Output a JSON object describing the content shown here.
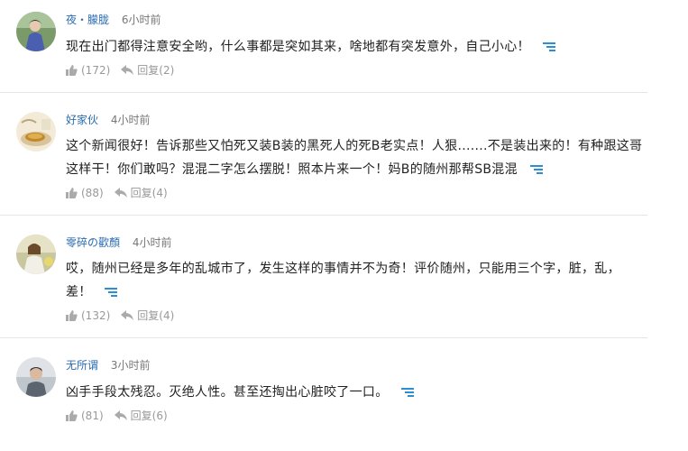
{
  "colors": {
    "username": "#2b6cb0",
    "timeago": "#777777",
    "action": "#999999",
    "more_icon": "#2b8fd6",
    "divider": "#e6e6e6"
  },
  "comments": [
    {
      "username": "夜・朦胧",
      "time": "6小时前",
      "content": "现在出门都得注意安全哟，什么事都是突如其来，啥地都有突发意外，自己小心！",
      "likes": "(172)",
      "reply_label": "回复",
      "reply_count": "(2)",
      "like_icon": "thumbs-up-icon",
      "reply_icon": "reply-arrow-icon",
      "more_icon": "expand-lines-icon"
    },
    {
      "username": "好家伙",
      "time": "4小时前",
      "content": "这个新闻很好！告诉那些又怕死又装B装的黑死人的死B老实点！人狠.......不是装出来的！有种跟这哥这样干！你们敢吗？混混二字怎么摆脱！照本片来一个！妈B的随州那帮SB混混",
      "likes": "(88)",
      "reply_label": "回复",
      "reply_count": "(4)",
      "like_icon": "thumbs-up-icon",
      "reply_icon": "reply-arrow-icon",
      "more_icon": "expand-lines-icon"
    },
    {
      "username": "零碎の歡顏",
      "time": "4小时前",
      "content": "哎，随州已经是多年的乱城市了，发生这样的事情并不为奇！评价随州，只能用三个字，脏，乱，差！",
      "likes": "(132)",
      "reply_label": "回复",
      "reply_count": "(4)",
      "like_icon": "thumbs-up-icon",
      "reply_icon": "reply-arrow-icon",
      "more_icon": "expand-lines-icon"
    },
    {
      "username": "无所谓",
      "time": "3小时前",
      "content": "凶手手段太残忍。灭绝人性。甚至还掏出心脏咬了一口。",
      "likes": "(81)",
      "reply_label": "回复",
      "reply_count": "(6)",
      "like_icon": "thumbs-up-icon",
      "reply_icon": "reply-arrow-icon",
      "more_icon": "expand-lines-icon"
    }
  ]
}
